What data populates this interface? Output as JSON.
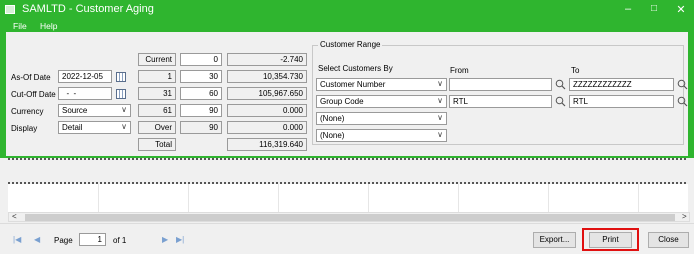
{
  "window": {
    "title": "SAMLTD - Customer Aging",
    "minimize": "–",
    "maximize": "□",
    "close": "✕"
  },
  "menu": {
    "file": "File",
    "help": "Help"
  },
  "form": {
    "as_of_date_label": "As-Of Date",
    "as_of_date": "2022-12-05",
    "cut_off_date_label": "Cut-Off Date",
    "cut_off_date": "  -  -",
    "currency_label": "Currency",
    "currency": "Source",
    "display_label": "Display",
    "display": "Detail"
  },
  "aging": {
    "rows": [
      {
        "label": "Current",
        "from": "",
        "to": "0",
        "amount": "-2.740"
      },
      {
        "label": "1",
        "from": "",
        "to": "30",
        "amount": "10,354.730"
      },
      {
        "label": "31",
        "from": "",
        "to": "60",
        "amount": "105,967.650"
      },
      {
        "label": "61",
        "from": "",
        "to": "90",
        "amount": "0.000"
      },
      {
        "label": "Over",
        "from": "",
        "to": "90",
        "amount": "0.000"
      }
    ],
    "total_label": "Total",
    "total": "116,319.640"
  },
  "customer_range": {
    "group_label": "Customer Range",
    "select_by_label": "Select Customers By",
    "from_label": "From",
    "to_label": "To",
    "rows": [
      {
        "by": "Customer Number",
        "from": "",
        "to": "ZZZZZZZZZZZZ"
      },
      {
        "by": "Group Code",
        "from": "RTL",
        "to": "RTL"
      },
      {
        "by": "(None)"
      },
      {
        "by": "(None)"
      }
    ]
  },
  "footer": {
    "page_label": "Page",
    "page_value": "1",
    "of_label": "of 1",
    "export_label": "Export...",
    "print_label": "Print",
    "close_label": "Close"
  },
  "colors": {
    "titlebar": "#2fb52f",
    "highlight": "#e01010"
  },
  "icons": [
    "app-icon",
    "calendar-icon",
    "finder-icon",
    "first-page-icon",
    "prev-page-icon",
    "next-page-icon",
    "last-page-icon"
  ]
}
